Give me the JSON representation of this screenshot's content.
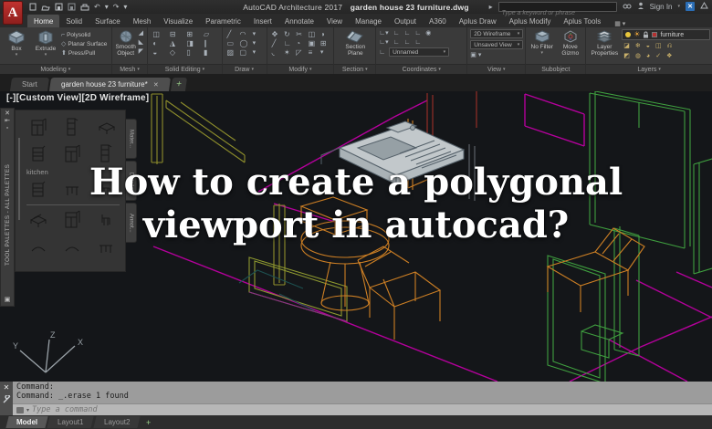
{
  "title_bar": {
    "app_title": "AutoCAD Architecture 2017",
    "doc_title": "garden house 23 furniture.dwg",
    "search_placeholder": "Type a keyword or phrase",
    "sign_in_label": "Sign In"
  },
  "ribbon": {
    "tabs": [
      "Home",
      "Solid",
      "Surface",
      "Mesh",
      "Visualize",
      "Parametric",
      "Insert",
      "Annotate",
      "View",
      "Manage",
      "Output",
      "A360",
      "Aplus Draw",
      "Aplus Modify",
      "Aplus Tools"
    ],
    "active_tab": "Home",
    "modeling": {
      "label": "Modeling",
      "box": "Box",
      "extrude": "Extrude",
      "polysolid": "Polysolid",
      "planar_surface": "Planar Surface",
      "press_pull": "Press/Pull"
    },
    "mesh": {
      "label": "Mesh",
      "smooth_object": "Smooth Object"
    },
    "solid_editing": {
      "label": "Solid Editing"
    },
    "draw": {
      "label": "Draw"
    },
    "modify": {
      "label": "Modify"
    },
    "section": {
      "label": "Section",
      "section_plane": "Section Plane"
    },
    "coordinates": {
      "label": "Coordinates",
      "ucs_dropdown_value": "Unnamed"
    },
    "view": {
      "label": "View",
      "visual_style": "2D Wireframe",
      "named_view": "Unsaved View"
    },
    "subobject": {
      "label": "Subobject",
      "no_filter": "No Filter",
      "move_gizmo": "Move Gizmo"
    },
    "layers": {
      "label": "Layers",
      "layer_properties": "Layer Properties",
      "current_layer": "furniture"
    }
  },
  "file_tabs": {
    "start": "Start",
    "drawing": "garden house 23 furniture*",
    "close": "✕",
    "add": "+"
  },
  "viewport_label": "[-][Custom View][2D Wireframe]",
  "palette": {
    "vertical_title": "TOOL PALETTES - ALL PALETTES",
    "group_label": "kitchen",
    "side_tab_1": "Mater...",
    "side_tab_2": "Details",
    "side_tab_3": "Annot..."
  },
  "overlay": {
    "line1": "How to create a polygonal",
    "line2": "viewport in autocad?"
  },
  "ucs": {
    "x_label": "X",
    "y_label": "Y",
    "z_label": "Z"
  },
  "command": {
    "history_line_1": "Command:",
    "history_line_2": "Command: _.erase 1 found",
    "input_placeholder": "Type a command"
  },
  "layout_tabs": {
    "model": "Model",
    "layout1": "Layout1",
    "layout2": "Layout2",
    "add": "+"
  },
  "colors": {
    "wire_magenta": "#b4009b",
    "wire_green": "#3f9f3f",
    "wire_orange": "#cd7f24",
    "wire_olive": "#8f8f2c",
    "canvas_bg": "#141619",
    "logo_red": "#c0322f"
  }
}
